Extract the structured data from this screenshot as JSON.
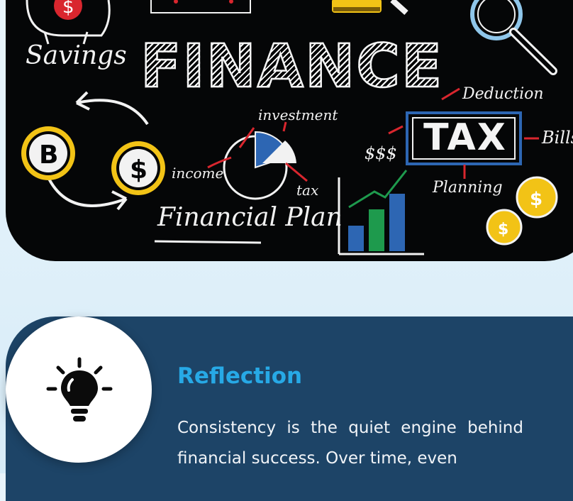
{
  "banner": {
    "title": "FINANCE",
    "labels": {
      "savings": "Savings",
      "investment": "investment",
      "income": "income",
      "tax_small": "tax",
      "financial_plan": "Financial Plan",
      "tax_big": "TAX",
      "deduction": "Deduction",
      "bills": "Bills",
      "dollars": "$$$",
      "planning": "Planning"
    },
    "colors": {
      "board": "#050607",
      "chalk": "#f2f2f2",
      "red": "#d9262e",
      "gold": "#f2c316",
      "blue": "#2d66b3",
      "green": "#1e9a4d"
    }
  },
  "reflection": {
    "icon": "lightbulb-icon",
    "title": "Reflection",
    "text": "Consistency is the quiet engine behind financial success. Over time, even",
    "colors": {
      "card": "#1d4467",
      "title": "#27a9e6",
      "text": "#f1f4f8"
    }
  }
}
